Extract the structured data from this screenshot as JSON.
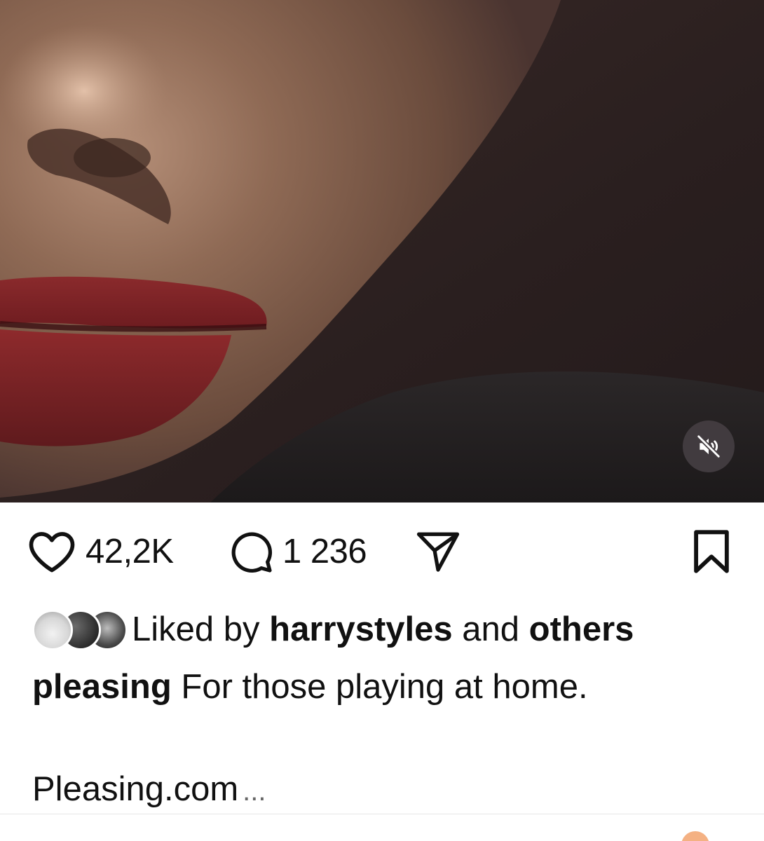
{
  "post": {
    "media": {
      "description_icon": "video-frame",
      "mute_icon": "speaker-muted-icon"
    },
    "actions": {
      "like_count": "42,2K",
      "comment_count": "1 236",
      "like_icon": "heart-icon",
      "comment_icon": "comment-bubble-icon",
      "share_icon": "paper-plane-icon",
      "save_icon": "bookmark-icon"
    },
    "liked_by": {
      "prefix": "Liked by",
      "user": "harrystyles",
      "connector": "and",
      "others": "others"
    },
    "caption": {
      "username": "pleasing",
      "text": "For those playing at home."
    },
    "link": {
      "text": "Pleasing.com",
      "more": "..."
    }
  },
  "colors": {
    "background": "#ffffff",
    "text": "#111111",
    "mute_button_bg": "#443e42",
    "lip_red": "#7e1e22",
    "skin": "#7a5a47"
  }
}
